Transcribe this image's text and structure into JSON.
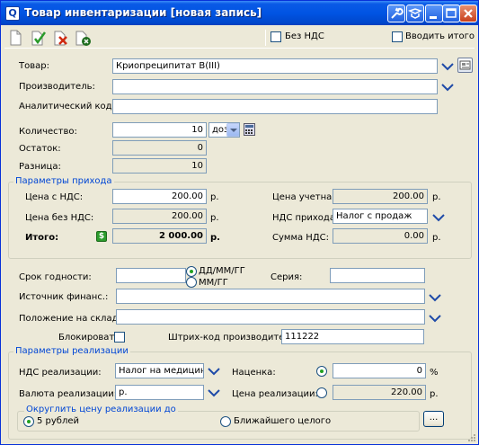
{
  "window": {
    "title": "Товар инвентаризации [новая запись]"
  },
  "toolbar": {
    "no_vat_label": "Без НДС",
    "enter_total_label": "Вводить итого"
  },
  "form": {
    "product_label": "Товар:",
    "product_value": "Криопреципитат В(III)",
    "manufacturer_label": "Производитель:",
    "manufacturer_value": "",
    "analytic_code_label": "Аналитический код:",
    "analytic_code_value": "",
    "quantity_label": "Количество:",
    "quantity_value": "10",
    "unit_value": "доз",
    "remainder_label": "Остаток:",
    "remainder_value": "0",
    "difference_label": "Разница:",
    "difference_value": "10"
  },
  "receipt": {
    "group_title": "Параметры прихода",
    "price_with_vat_label": "Цена с НДС:",
    "price_with_vat_value": "200.00",
    "price_without_vat_label": "Цена без НДС:",
    "price_without_vat_value": "200.00",
    "total_label": "Итого:",
    "total_value": "2 000.00",
    "currency": "р.",
    "account_price_label": "Цена учетная:",
    "account_price_value": "200.00",
    "receipt_vat_label": "НДС прихода:",
    "receipt_vat_value": "Налог с продаж",
    "vat_sum_label": "Сумма НДС:",
    "vat_sum_value": "0.00"
  },
  "extra": {
    "expiry_label": "Срок годности:",
    "expiry_value": "",
    "fmt_full": "ДД/ММ/ГГ",
    "fmt_short": "ММ/ГГ",
    "series_label": "Серия:",
    "series_value": "",
    "funding_label": "Источник финанс.:",
    "funding_value": "",
    "storage_label": "Положение на складе:",
    "storage_value": "",
    "block_label": "Блокировать",
    "barcode_label": "Штрих-код производителя:",
    "barcode_value": "111222"
  },
  "sales": {
    "group_title": "Параметры реализации",
    "sales_vat_label": "НДС реализации:",
    "sales_vat_value": "Налог на медицинск",
    "currency_label": "Валюта реализации:",
    "currency_value": "р.",
    "markup_label": "Наценка:",
    "markup_value": "0",
    "markup_unit": "%",
    "sale_price_label": "Цена реализации:",
    "sale_price_value": "220.00",
    "sale_price_unit": "р.",
    "rounding_title": "Округлить цену реализации до",
    "round_5": "5 рублей",
    "round_whole": "Ближайшего целого",
    "more_button": "..."
  },
  "colors": {
    "title_bar": "#0054e3",
    "group_title": "#0046d5",
    "window_bg": "#ece9d8",
    "border": "#7f9db9"
  }
}
